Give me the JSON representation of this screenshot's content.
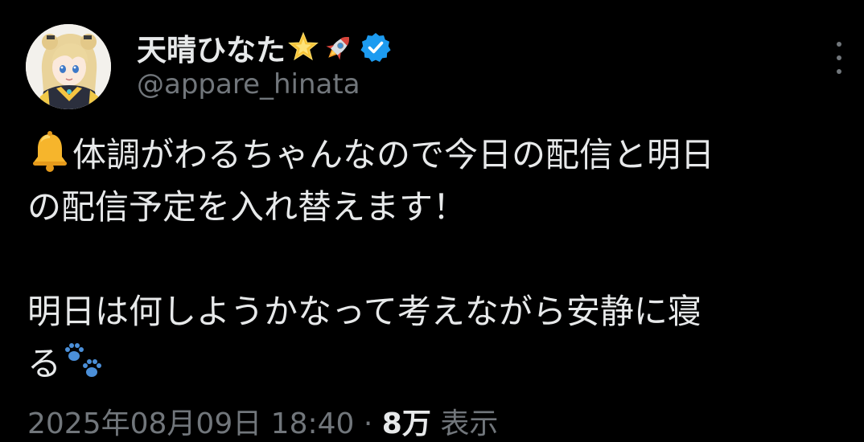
{
  "author": {
    "display_name": "天晴ひなた",
    "name_emojis": [
      "glowing-star-icon",
      "rocket-icon"
    ],
    "verified": true,
    "handle": "@appare_hinata"
  },
  "post": {
    "lines": [
      "体調がわるちゃんなので今日の配信と明日",
      "の配信予定を入れ替えます！",
      "",
      "明日は何しようかなって考えながら安静に寝",
      "る"
    ],
    "leading_emoji": "bell-icon",
    "trailing_emoji": "paw-prints-icon"
  },
  "meta": {
    "timestamp": "2025年08月09日 18:40",
    "separator": "·",
    "views_count": "8万",
    "views_label": "表示"
  },
  "colors": {
    "background": "#000000",
    "text_primary": "#e7e9ea",
    "text_secondary": "#71767b",
    "verified_blue": "#1d9bf0"
  }
}
